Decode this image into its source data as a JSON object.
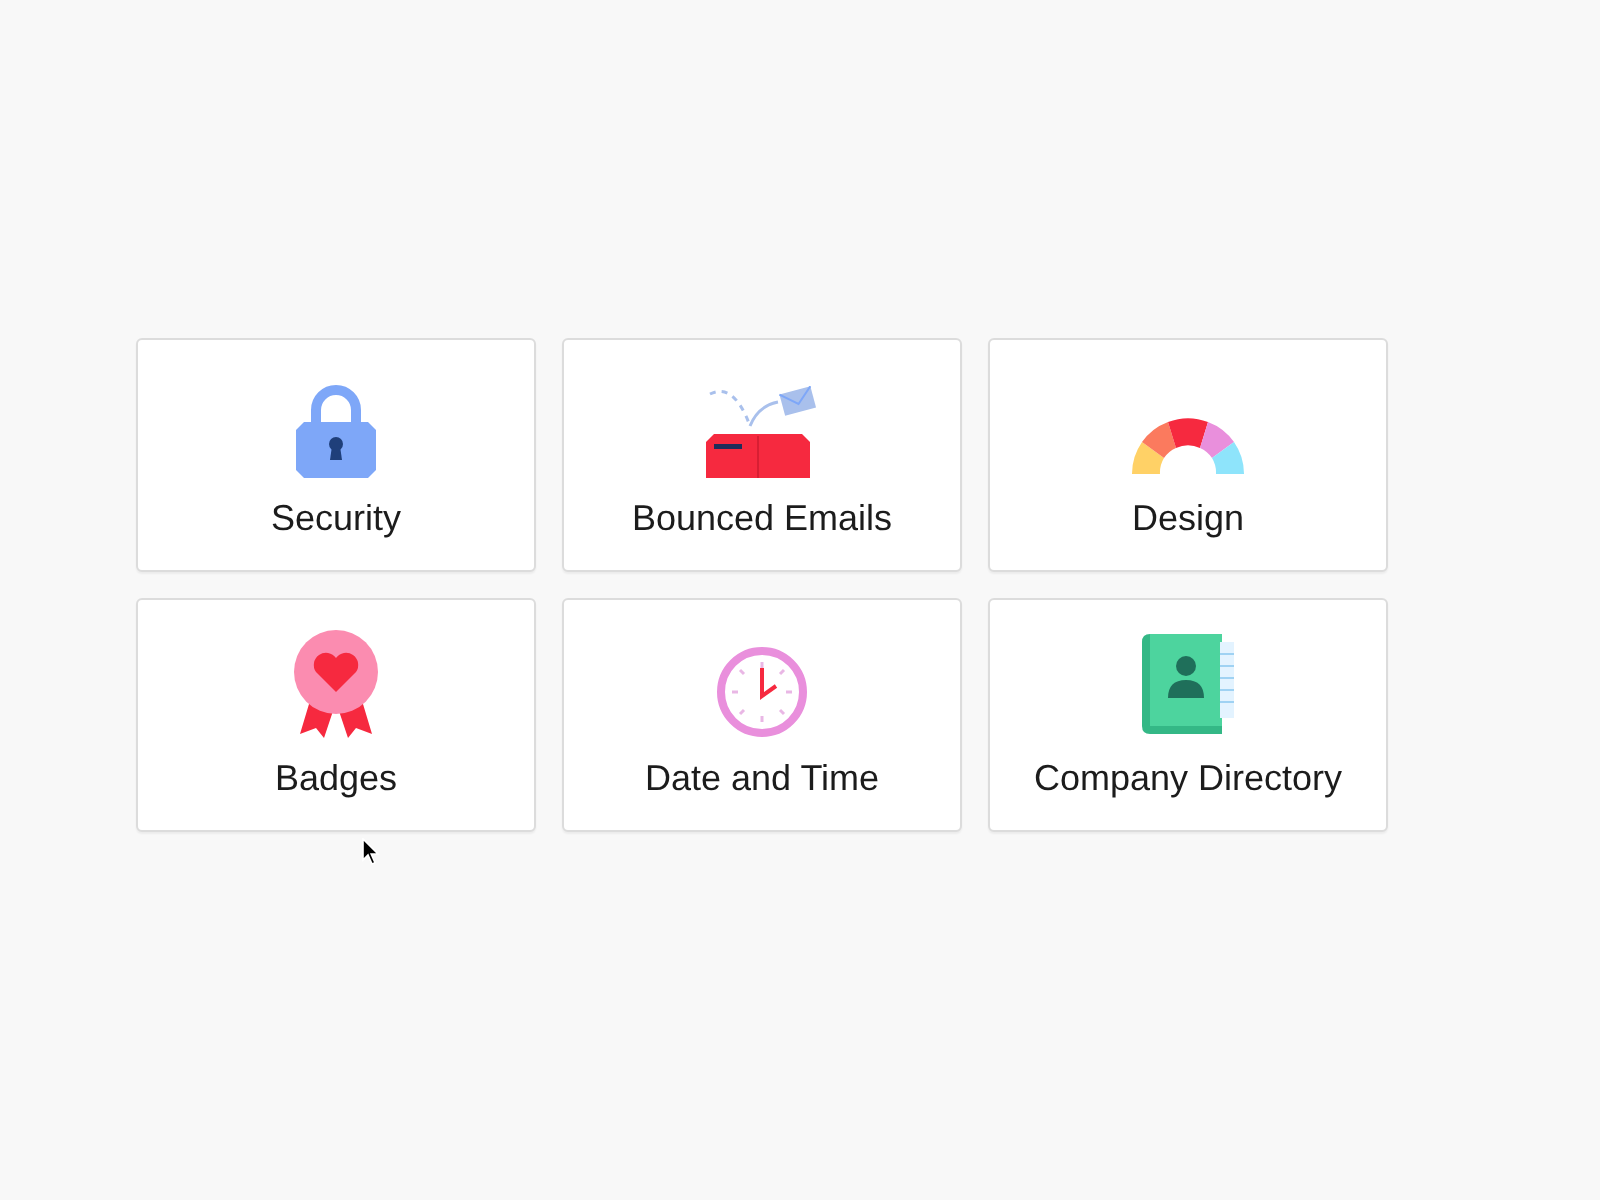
{
  "tiles": [
    {
      "label": "Security",
      "kind": "lock"
    },
    {
      "label": "Bounced Emails",
      "kind": "mailbox"
    },
    {
      "label": "Design",
      "kind": "palette"
    },
    {
      "label": "Badges",
      "kind": "badge"
    },
    {
      "label": "Date and Time",
      "kind": "clock"
    },
    {
      "label": "Company Directory",
      "kind": "book"
    }
  ]
}
